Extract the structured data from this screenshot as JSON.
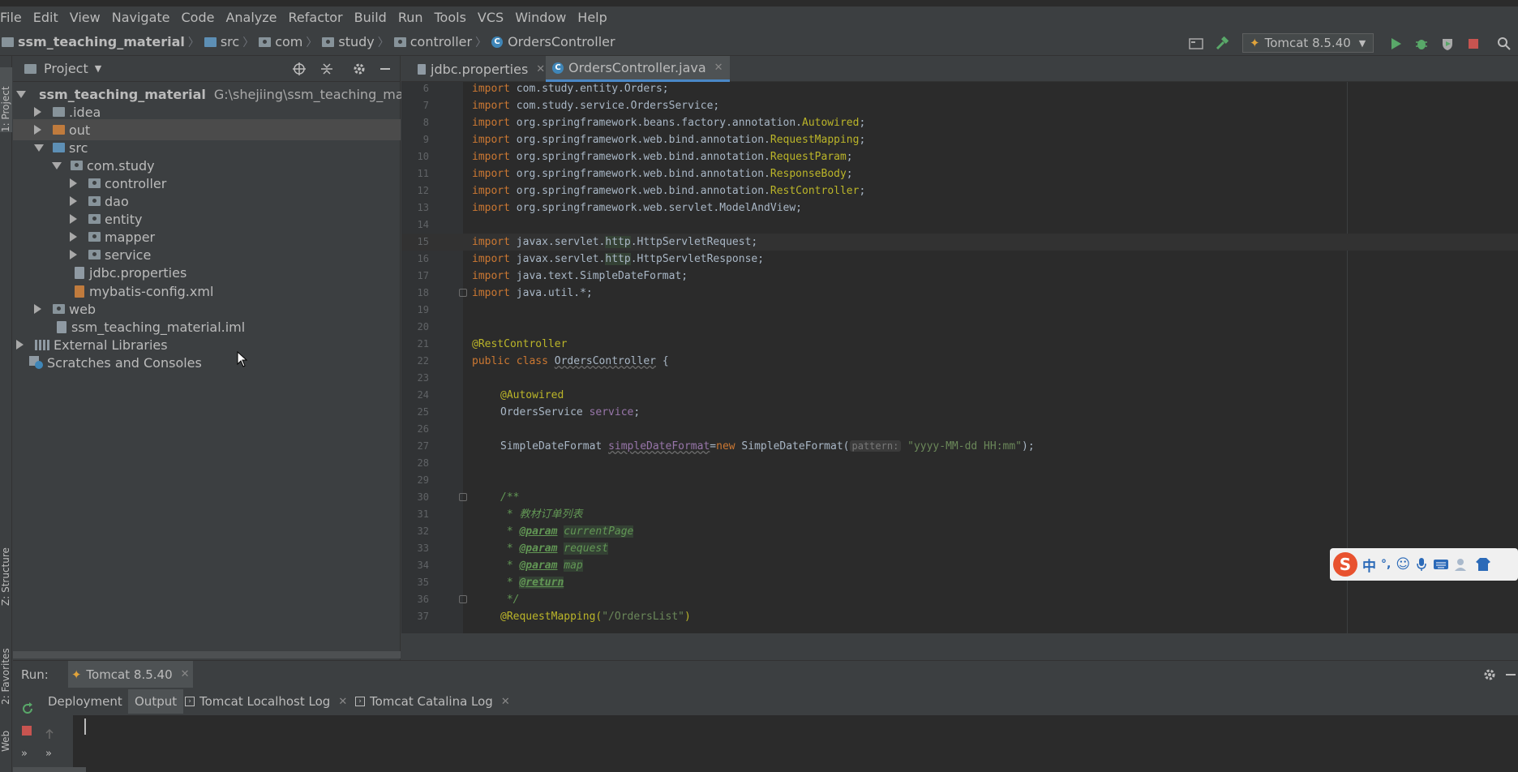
{
  "menu": [
    "File",
    "Edit",
    "View",
    "Navigate",
    "Code",
    "Analyze",
    "Refactor",
    "Build",
    "Run",
    "Tools",
    "VCS",
    "Window",
    "Help"
  ],
  "breadcrumb": [
    "ssm_teaching_material",
    "src",
    "com",
    "study",
    "controller",
    "OrdersController"
  ],
  "toolbar": {
    "run_config": "Tomcat 8.5.40"
  },
  "left_strip": {
    "project": "1: Project",
    "structure": "Z: Structure",
    "favorites": "2: Favorites",
    "web": "Web"
  },
  "project_panel": {
    "title": "Project",
    "tree": [
      {
        "label": "ssm_teaching_material",
        "path": "G:\\shejiing\\ssm_teaching_material"
      },
      {
        "label": ".idea"
      },
      {
        "label": "out"
      },
      {
        "label": "src"
      },
      {
        "label": "com.study"
      },
      {
        "label": "controller"
      },
      {
        "label": "dao"
      },
      {
        "label": "entity"
      },
      {
        "label": "mapper"
      },
      {
        "label": "service"
      },
      {
        "label": "jdbc.properties"
      },
      {
        "label": "mybatis-config.xml"
      },
      {
        "label": "web"
      },
      {
        "label": "ssm_teaching_material.iml"
      },
      {
        "label": "External Libraries"
      },
      {
        "label": "Scratches and Consoles"
      }
    ]
  },
  "editor_tabs": [
    "jdbc.properties",
    "OrdersController.java"
  ],
  "code": {
    "line_numbers": [
      "6",
      "7",
      "8",
      "9",
      "10",
      "11",
      "12",
      "13",
      "14",
      "15",
      "16",
      "17",
      "18",
      "19",
      "20",
      "21",
      "22",
      "23",
      "24",
      "25",
      "26",
      "27",
      "28",
      "29",
      "30",
      "31",
      "32",
      "33",
      "34",
      "35",
      "36",
      "37"
    ],
    "import_entity": "com.study.entity.Orders;",
    "import_service": "com.study.service.OrdersService;",
    "beans_pkg": "org.springframework.beans.factory.annotation.",
    "autowired": "Autowired",
    "bind_pkg": "org.springframework.web.bind.annotation.",
    "request_mapping": "RequestMapping",
    "request_param": "RequestParam",
    "response_body": "ResponseBody",
    "rest_controller": "RestController",
    "model_and_view": "org.springframework.web.servlet.ModelAndView;",
    "servlet_pkg": "javax.servlet.",
    "http": "http",
    "http_request": ".HttpServletRequest;",
    "http_response": ".HttpServletResponse;",
    "simple_date": "java.text.SimpleDateFormat;",
    "util": "java.util.*;",
    "rest_anno": "@RestController",
    "public": "public",
    "class": "class",
    "class_name": "OrdersController",
    "brace": " {",
    "autowired_anno": "@Autowired",
    "service_type": "OrdersService ",
    "service_field": "service",
    "semi": ";",
    "sdf_type": "SimpleDateFormat ",
    "sdf_field": "simpleDateFormat",
    "eq": "=",
    "new": "new",
    "sdf_ctor": " SimpleDateFormat(",
    "hint_pattern": "pattern:",
    "pattern_value": "\"yyyy-MM-dd HH:mm\"",
    "close": ");",
    "javadoc_open": "/**",
    "javadoc_title": " * 教材订单列表",
    "star": " * ",
    "param_tag": "@param",
    "p_current": "currentPage",
    "p_request": "request",
    "p_map": "map",
    "return_tag": "@return",
    "javadoc_close": " */",
    "mapping_anno": "@RequestMapping(",
    "mapping_path": "\"/OrdersList\"",
    "paren": ")",
    "import": "import"
  },
  "ime": {
    "logo": "S",
    "mode": "中",
    "punct": "°,"
  },
  "run_panel": {
    "label": "Run:",
    "config": "Tomcat 8.5.40",
    "tabs": [
      "Deployment",
      "Output",
      "Tomcat Localhost Log",
      "Tomcat Catalina Log"
    ]
  }
}
